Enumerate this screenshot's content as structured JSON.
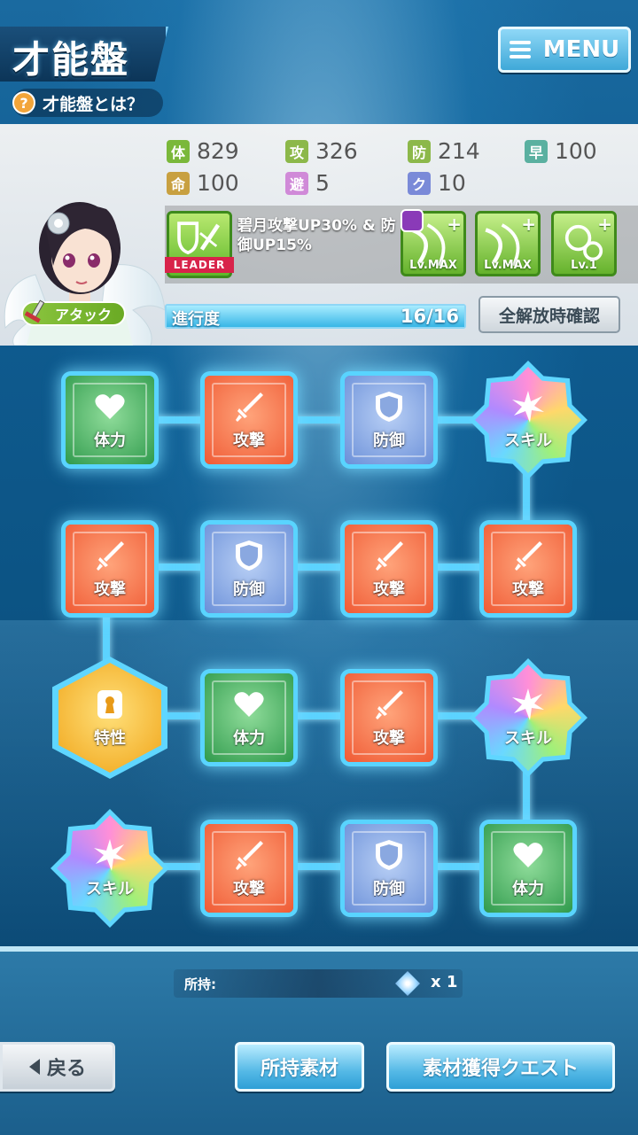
{
  "header": {
    "title": "才能盤",
    "help_icon": "?",
    "help_text": "才能盤とは？",
    "menu_label": "MENU"
  },
  "character": {
    "role_tag": "アタック",
    "stats": [
      {
        "icon": "体",
        "value": "829",
        "color": "#7ab83a"
      },
      {
        "icon": "攻",
        "value": "326",
        "color": "#8cb84a"
      },
      {
        "icon": "防",
        "value": "214",
        "color": "#8cb84a"
      },
      {
        "icon": "早",
        "value": "100",
        "color": "#5ab0a0"
      },
      {
        "icon": "命",
        "value": "100",
        "color": "#c8a040"
      },
      {
        "icon": "避",
        "value": "5",
        "color": "#d08ad8"
      },
      {
        "icon": "ク",
        "value": "10",
        "color": "#7a8ad8"
      }
    ],
    "leader": {
      "tag": "LEADER",
      "description": "碧月攻撃UP30% & 防御UP15%"
    },
    "skills": [
      {
        "level": "Lv.MAX",
        "plus": "+"
      },
      {
        "level": "Lv.MAX",
        "plus": "+"
      },
      {
        "level": "Lv.1",
        "plus": "+"
      }
    ],
    "progress": {
      "label": "進行度",
      "current": 16,
      "total": 16,
      "text": "16/16"
    },
    "confirm_label": "全解放時確認"
  },
  "board": {
    "rows": [
      [
        {
          "type": "green",
          "label": "体力",
          "icon": "heart-icon"
        },
        {
          "type": "orange",
          "label": "攻撃",
          "icon": "sword-icon"
        },
        {
          "type": "blue",
          "label": "防御",
          "icon": "shield-icon"
        },
        {
          "type": "star",
          "label": "スキル",
          "icon": "burst-icon"
        }
      ],
      [
        {
          "type": "orange",
          "label": "攻撃",
          "icon": "sword-icon"
        },
        {
          "type": "blue",
          "label": "防御",
          "icon": "shield-icon"
        },
        {
          "type": "orange",
          "label": "攻撃",
          "icon": "sword-icon"
        },
        {
          "type": "orange",
          "label": "攻撃",
          "icon": "sword-icon"
        }
      ],
      [
        {
          "type": "hex",
          "label": "特性",
          "icon": "keyhole-icon"
        },
        {
          "type": "green",
          "label": "体力",
          "icon": "heart-icon"
        },
        {
          "type": "orange",
          "label": "攻撃",
          "icon": "sword-icon"
        },
        {
          "type": "star",
          "label": "スキル",
          "icon": "burst-icon"
        }
      ],
      [
        {
          "type": "star",
          "label": "スキル",
          "icon": "burst-icon"
        },
        {
          "type": "orange",
          "label": "攻撃",
          "icon": "sword-icon"
        },
        {
          "type": "blue",
          "label": "防御",
          "icon": "shield-icon"
        },
        {
          "type": "green",
          "label": "体力",
          "icon": "heart-icon"
        }
      ]
    ]
  },
  "footer": {
    "owned_label": "所持:",
    "owned_count": "x 1",
    "back_label": "戻る",
    "materials_label": "所持素材",
    "quest_label": "素材獲得クエスト"
  }
}
